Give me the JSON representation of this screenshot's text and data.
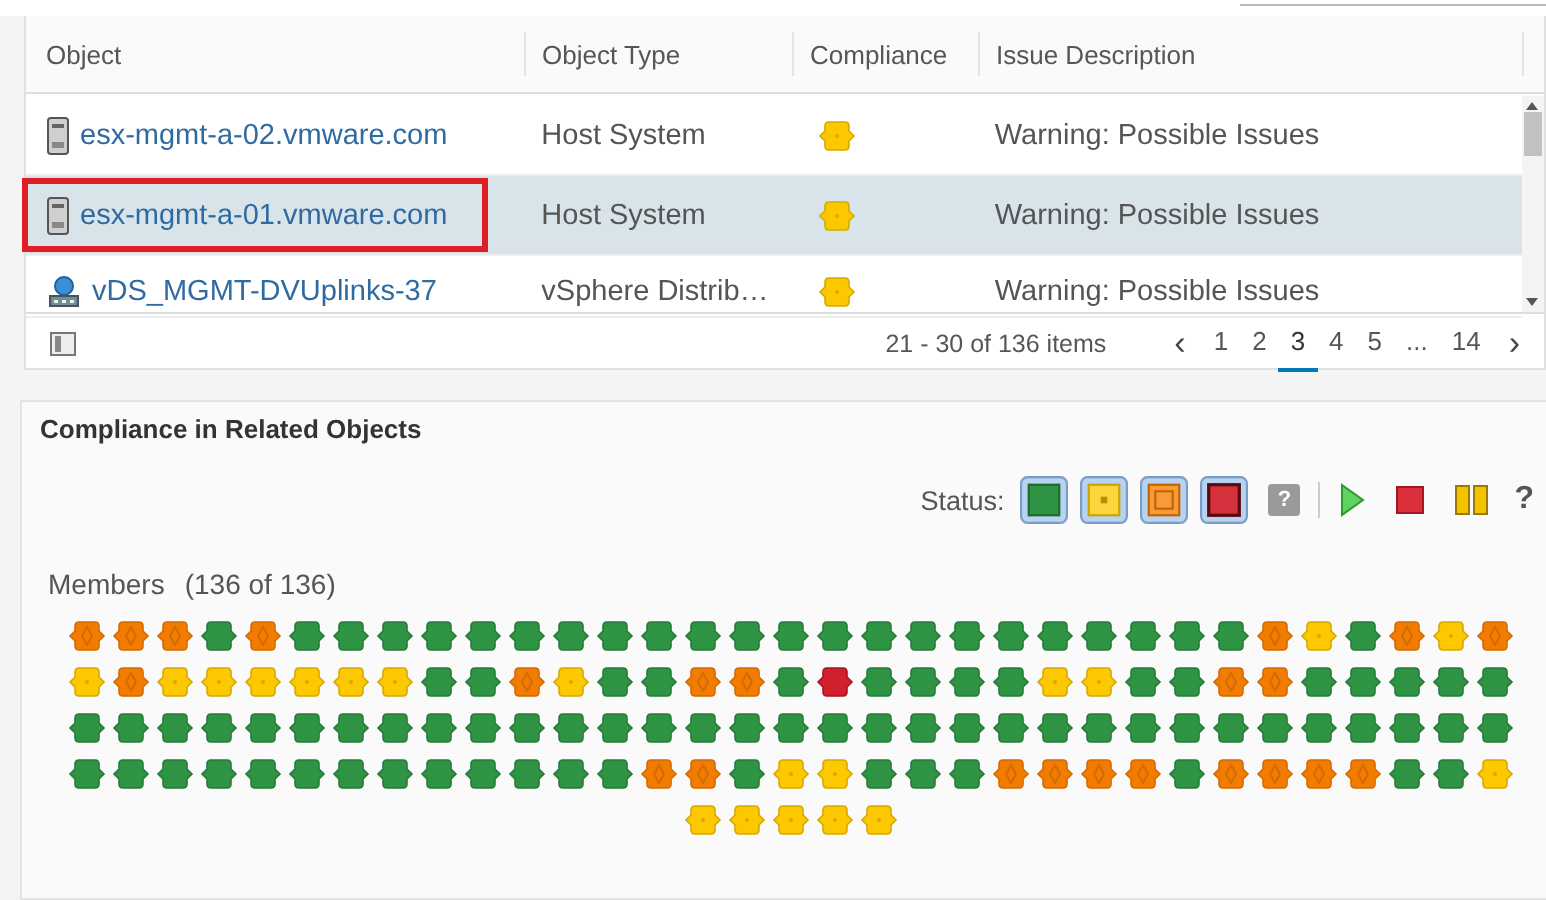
{
  "table": {
    "columns": [
      "Object",
      "Object Type",
      "Compliance",
      "Issue Description"
    ],
    "rows": [
      {
        "object": {
          "text": "esx-mgmt-a-02.vmware.com",
          "kind": "host"
        },
        "type": "Host System",
        "compliance": {
          "kind": "warning"
        },
        "issue": "Warning: Possible Issues",
        "selected": false,
        "highlighted": false
      },
      {
        "object": {
          "text": "esx-mgmt-a-01.vmware.com",
          "kind": "host"
        },
        "type": "Host System",
        "compliance": {
          "kind": "warning"
        },
        "issue": "Warning: Possible Issues",
        "selected": true,
        "highlighted": true
      },
      {
        "object": {
          "text": "vDS_MGMT-DVUplinks-37",
          "kind": "network"
        },
        "type": "vSphere Distrib…",
        "compliance": {
          "kind": "warning"
        },
        "issue": "Warning: Possible Issues",
        "selected": false,
        "highlighted": false
      }
    ],
    "footer": {
      "range": "21 - 30 of 136 items",
      "prev": "‹",
      "next": "›",
      "pages": [
        {
          "label": "1",
          "selected": false
        },
        {
          "label": "2",
          "selected": false
        },
        {
          "label": "3",
          "selected": true
        },
        {
          "label": "4",
          "selected": false
        },
        {
          "label": "5",
          "selected": false
        },
        {
          "label": "...",
          "selected": false
        },
        {
          "label": "14",
          "selected": false
        }
      ]
    }
  },
  "related": {
    "title": "Compliance in Related Objects",
    "status_label": "Status:",
    "filters": [
      {
        "kind": "ok",
        "on": true
      },
      {
        "kind": "warning",
        "on": true
      },
      {
        "kind": "alert",
        "on": true
      },
      {
        "kind": "critical",
        "on": true
      }
    ],
    "unknown": "?",
    "help": "?",
    "members_label": "Members",
    "members_count": "(136 of 136)",
    "members": [
      {
        "kind": "alert"
      },
      {
        "kind": "alert"
      },
      {
        "kind": "alert"
      },
      {
        "kind": "ok"
      },
      {
        "kind": "alert"
      },
      {
        "kind": "ok"
      },
      {
        "kind": "ok"
      },
      {
        "kind": "ok"
      },
      {
        "kind": "ok"
      },
      {
        "kind": "ok"
      },
      {
        "kind": "ok"
      },
      {
        "kind": "ok"
      },
      {
        "kind": "ok"
      },
      {
        "kind": "ok"
      },
      {
        "kind": "ok"
      },
      {
        "kind": "ok"
      },
      {
        "kind": "ok"
      },
      {
        "kind": "ok"
      },
      {
        "kind": "ok"
      },
      {
        "kind": "ok"
      },
      {
        "kind": "ok"
      },
      {
        "kind": "ok"
      },
      {
        "kind": "ok"
      },
      {
        "kind": "ok"
      },
      {
        "kind": "ok"
      },
      {
        "kind": "ok"
      },
      {
        "kind": "ok"
      },
      {
        "kind": "alert"
      },
      {
        "kind": "warning"
      },
      {
        "kind": "ok"
      },
      {
        "kind": "alert"
      },
      {
        "kind": "warning"
      },
      {
        "kind": "alert"
      },
      {
        "kind": "warning"
      },
      {
        "kind": "alert"
      },
      {
        "kind": "warning"
      },
      {
        "kind": "warning"
      },
      {
        "kind": "warning"
      },
      {
        "kind": "warning"
      },
      {
        "kind": "warning"
      },
      {
        "kind": "warning"
      },
      {
        "kind": "ok"
      },
      {
        "kind": "ok"
      },
      {
        "kind": "alert"
      },
      {
        "kind": "warning"
      },
      {
        "kind": "ok"
      },
      {
        "kind": "ok"
      },
      {
        "kind": "alert"
      },
      {
        "kind": "alert"
      },
      {
        "kind": "ok"
      },
      {
        "kind": "critical"
      },
      {
        "kind": "ok"
      },
      {
        "kind": "ok"
      },
      {
        "kind": "ok"
      },
      {
        "kind": "ok"
      },
      {
        "kind": "warning"
      },
      {
        "kind": "warning"
      },
      {
        "kind": "ok"
      },
      {
        "kind": "ok"
      },
      {
        "kind": "alert"
      },
      {
        "kind": "alert"
      },
      {
        "kind": "ok"
      },
      {
        "kind": "ok"
      },
      {
        "kind": "ok"
      },
      {
        "kind": "ok"
      },
      {
        "kind": "ok"
      },
      {
        "kind": "ok"
      },
      {
        "kind": "ok"
      },
      {
        "kind": "ok"
      },
      {
        "kind": "ok"
      },
      {
        "kind": "ok"
      },
      {
        "kind": "ok"
      },
      {
        "kind": "ok"
      },
      {
        "kind": "ok"
      },
      {
        "kind": "ok"
      },
      {
        "kind": "ok"
      },
      {
        "kind": "ok"
      },
      {
        "kind": "ok"
      },
      {
        "kind": "ok"
      },
      {
        "kind": "ok"
      },
      {
        "kind": "ok"
      },
      {
        "kind": "ok"
      },
      {
        "kind": "ok"
      },
      {
        "kind": "ok"
      },
      {
        "kind": "ok"
      },
      {
        "kind": "ok"
      },
      {
        "kind": "ok"
      },
      {
        "kind": "ok"
      },
      {
        "kind": "ok"
      },
      {
        "kind": "ok"
      },
      {
        "kind": "ok"
      },
      {
        "kind": "ok"
      },
      {
        "kind": "ok"
      },
      {
        "kind": "ok"
      },
      {
        "kind": "ok"
      },
      {
        "kind": "ok"
      },
      {
        "kind": "ok"
      },
      {
        "kind": "ok"
      },
      {
        "kind": "ok"
      },
      {
        "kind": "ok"
      },
      {
        "kind": "ok"
      },
      {
        "kind": "ok"
      },
      {
        "kind": "ok"
      },
      {
        "kind": "ok"
      },
      {
        "kind": "ok"
      },
      {
        "kind": "ok"
      },
      {
        "kind": "ok"
      },
      {
        "kind": "ok"
      },
      {
        "kind": "ok"
      },
      {
        "kind": "ok"
      },
      {
        "kind": "ok"
      },
      {
        "kind": "ok"
      },
      {
        "kind": "alert"
      },
      {
        "kind": "alert"
      },
      {
        "kind": "ok"
      },
      {
        "kind": "warning"
      },
      {
        "kind": "warning"
      },
      {
        "kind": "ok"
      },
      {
        "kind": "ok"
      },
      {
        "kind": "ok"
      },
      {
        "kind": "alert"
      },
      {
        "kind": "alert"
      },
      {
        "kind": "alert"
      },
      {
        "kind": "alert"
      },
      {
        "kind": "ok"
      },
      {
        "kind": "alert"
      },
      {
        "kind": "alert"
      },
      {
        "kind": "alert"
      },
      {
        "kind": "alert"
      },
      {
        "kind": "ok"
      },
      {
        "kind": "ok"
      },
      {
        "kind": "warning"
      },
      {
        "kind": "warning"
      },
      {
        "kind": "warning"
      },
      {
        "kind": "warning"
      },
      {
        "kind": "warning"
      },
      {
        "kind": "warning"
      }
    ]
  }
}
